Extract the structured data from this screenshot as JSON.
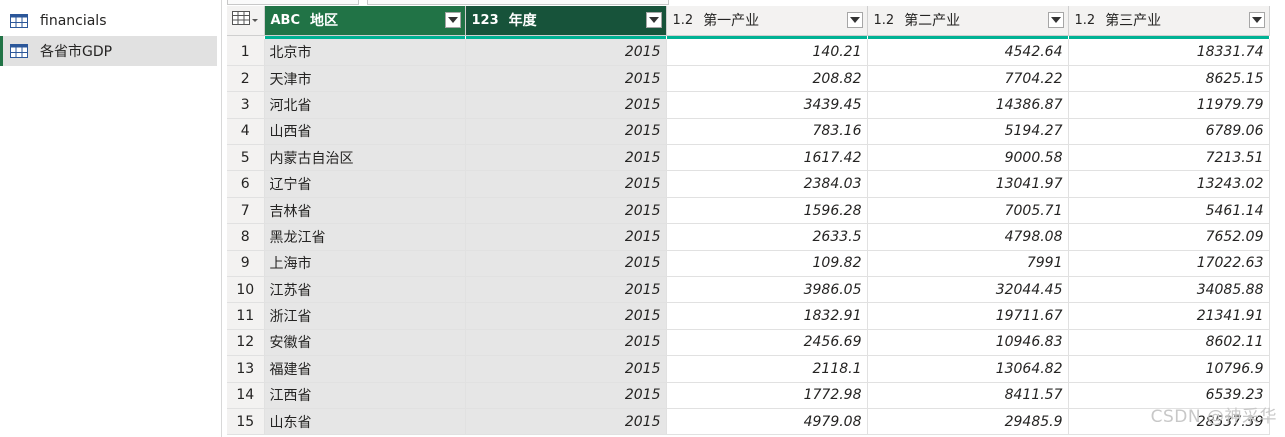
{
  "queries": [
    {
      "label": "financials",
      "selected": false
    },
    {
      "label": "各省市GDP",
      "selected": true
    }
  ],
  "columns": [
    {
      "type_icon": "ABC",
      "name": "地区",
      "style": "dark"
    },
    {
      "type_icon": "123",
      "name": "年度",
      "style": "dark2"
    },
    {
      "type_icon": "1.2",
      "name": "第一产业",
      "style": "light"
    },
    {
      "type_icon": "1.2",
      "name": "第二产业",
      "style": "light"
    },
    {
      "type_icon": "1.2",
      "name": "第三产业",
      "style": "light"
    }
  ],
  "rows": [
    {
      "n": "1",
      "region": "北京市",
      "year": "2015",
      "v1": "140.21",
      "v2": "4542.64",
      "v3": "18331.74"
    },
    {
      "n": "2",
      "region": "天津市",
      "year": "2015",
      "v1": "208.82",
      "v2": "7704.22",
      "v3": "8625.15"
    },
    {
      "n": "3",
      "region": "河北省",
      "year": "2015",
      "v1": "3439.45",
      "v2": "14386.87",
      "v3": "11979.79"
    },
    {
      "n": "4",
      "region": "山西省",
      "year": "2015",
      "v1": "783.16",
      "v2": "5194.27",
      "v3": "6789.06"
    },
    {
      "n": "5",
      "region": "内蒙古自治区",
      "year": "2015",
      "v1": "1617.42",
      "v2": "9000.58",
      "v3": "7213.51"
    },
    {
      "n": "6",
      "region": "辽宁省",
      "year": "2015",
      "v1": "2384.03",
      "v2": "13041.97",
      "v3": "13243.02"
    },
    {
      "n": "7",
      "region": "吉林省",
      "year": "2015",
      "v1": "1596.28",
      "v2": "7005.71",
      "v3": "5461.14"
    },
    {
      "n": "8",
      "region": "黑龙江省",
      "year": "2015",
      "v1": "2633.5",
      "v2": "4798.08",
      "v3": "7652.09"
    },
    {
      "n": "9",
      "region": "上海市",
      "year": "2015",
      "v1": "109.82",
      "v2": "7991",
      "v3": "17022.63"
    },
    {
      "n": "10",
      "region": "江苏省",
      "year": "2015",
      "v1": "3986.05",
      "v2": "32044.45",
      "v3": "34085.88"
    },
    {
      "n": "11",
      "region": "浙江省",
      "year": "2015",
      "v1": "1832.91",
      "v2": "19711.67",
      "v3": "21341.91"
    },
    {
      "n": "12",
      "region": "安徽省",
      "year": "2015",
      "v1": "2456.69",
      "v2": "10946.83",
      "v3": "8602.11"
    },
    {
      "n": "13",
      "region": "福建省",
      "year": "2015",
      "v1": "2118.1",
      "v2": "13064.82",
      "v3": "10796.9"
    },
    {
      "n": "14",
      "region": "江西省",
      "year": "2015",
      "v1": "1772.98",
      "v2": "8411.57",
      "v3": "6539.23"
    },
    {
      "n": "15",
      "region": "山东省",
      "year": "2015",
      "v1": "4979.08",
      "v2": "29485.9",
      "v3": "28537.39"
    }
  ],
  "watermark": "CSDN @神采华",
  "colors": {
    "accent": "#217346",
    "quality_bar": "#00b294",
    "header_dark": "#17533a"
  },
  "icons": {
    "query": "table-icon",
    "corner": "table-menu-icon",
    "filter": "dropdown-icon"
  }
}
